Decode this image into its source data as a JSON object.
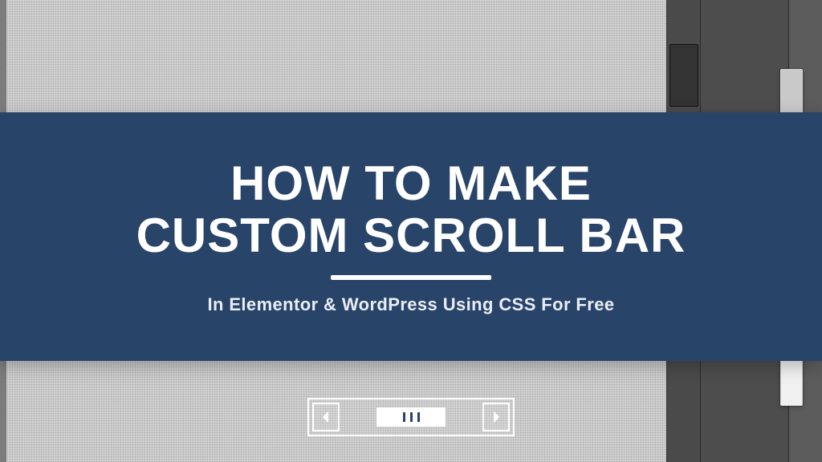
{
  "heading": {
    "line1": "HOW TO MAKE",
    "line2": "CUSTOM SCROLL BAR"
  },
  "subheading": "In Elementor & WordPress Using CSS For Free",
  "colors": {
    "band": "#294469",
    "text": "#ffffff"
  },
  "h_scrollbar": {
    "left_arrow": "left",
    "right_arrow": "right"
  }
}
